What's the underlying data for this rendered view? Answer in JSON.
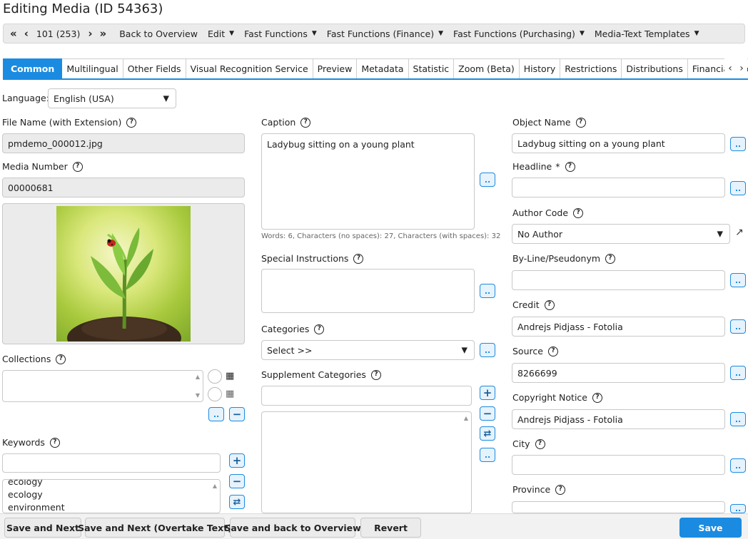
{
  "title": "Editing Media (ID 54363)",
  "toolbar": {
    "first": "«",
    "prev": "‹",
    "position": "101 (253)",
    "next": "›",
    "last": "»",
    "back": "Back to Overview",
    "edit": "Edit",
    "fast_functions": "Fast Functions",
    "fast_finance": "Fast Functions (Finance)",
    "fast_purchasing": "Fast Functions (Purchasing)",
    "media_text": "Media-Text Templates"
  },
  "tabs": [
    "Common",
    "Multilingual",
    "Other Fields",
    "Visual Recognition Service",
    "Preview",
    "Metadata",
    "Statistic",
    "Zoom (Beta)",
    "History",
    "Restrictions",
    "Distributions",
    "Financial Docum"
  ],
  "language": {
    "label": "Language:",
    "value": "English (USA)"
  },
  "left": {
    "file_name_label": "File Name (with Extension)",
    "file_name_value": "pmdemo_000012.jpg",
    "media_number_label": "Media Number",
    "media_number_value": "00000681",
    "collections_label": "Collections",
    "keywords_label": "Keywords",
    "keywords": [
      "ecology",
      "ecology",
      "environment"
    ]
  },
  "middle": {
    "caption_label": "Caption",
    "caption_value": "Ladybug sitting on a young plant",
    "word_count": "Words: 6, Characters (no spaces): 27, Characters (with spaces): 32",
    "special_label": "Special Instructions",
    "categories_label": "Categories",
    "categories_value": "Select >>",
    "supplement_label": "Supplement Categories"
  },
  "right": {
    "object_name_label": "Object Name",
    "object_name_value": "Ladybug sitting on a young plant",
    "headline_label": "Headline",
    "headline_required": "*",
    "author_code_label": "Author Code",
    "author_code_value": "No Author",
    "byline_label": "By-Line/Pseudonym",
    "credit_label": "Credit",
    "credit_value": "Andrejs Pidjass - Fotolia",
    "source_label": "Source",
    "source_value": "8266699",
    "copyright_label": "Copyright Notice",
    "copyright_value": "Andrejs Pidjass - Fotolia",
    "city_label": "City",
    "province_label": "Province"
  },
  "footer": {
    "save_next": "Save and Next",
    "save_next_overtake": "Save and Next (Overtake Text)",
    "save_back": "Save and back to Overview",
    "revert": "Revert",
    "save": "Save"
  },
  "icons": {
    "help": "?",
    "dots": "..",
    "plus": "+",
    "minus": "−",
    "swap": "⇄",
    "caret": "⌄",
    "external": "↗"
  },
  "colors": {
    "accent": "#1a8be0"
  }
}
